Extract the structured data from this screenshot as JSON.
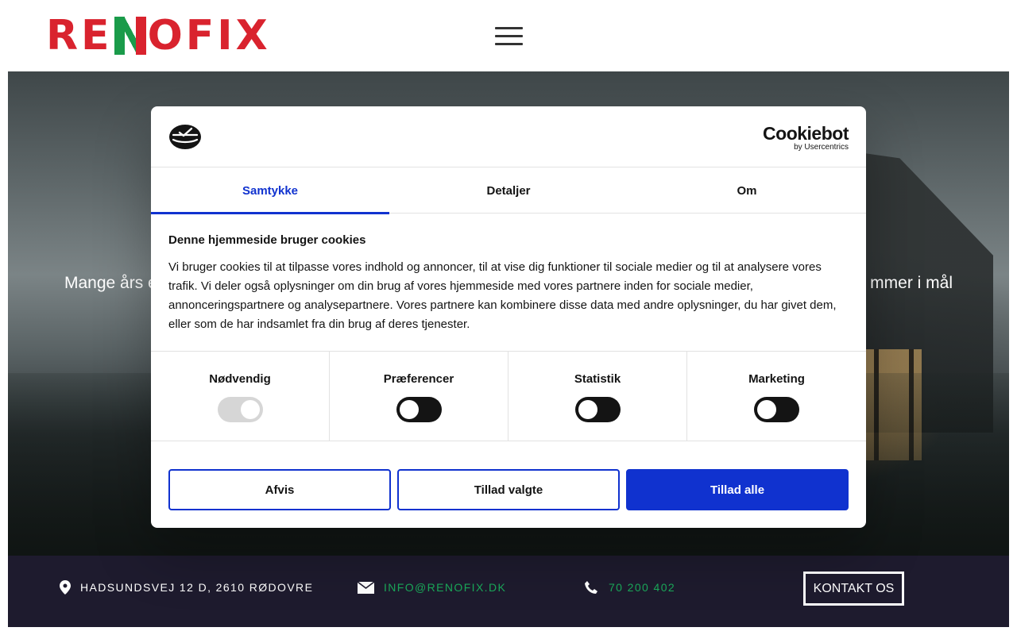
{
  "header": {
    "logo_letters": {
      "pre": "RE",
      "post": "OFIX"
    },
    "menu_icon": "hamburger-icon"
  },
  "hero": {
    "text_left": "Mange års e",
    "text_right": "mmer i mål"
  },
  "contact": {
    "address": "HADSUNDSVEJ 12 D, 2610 RØDOVRE",
    "email": "INFO@RENOFIX.DK",
    "phone": "70 200 402",
    "button_label": "KONTAKT OS",
    "icons": [
      "map-pin-icon",
      "envelope-icon",
      "phone-icon"
    ]
  },
  "cookie_dialog": {
    "brand": {
      "name": "Cookiebot",
      "by": "by Usercentrics"
    },
    "tabs": [
      {
        "label": "Samtykke",
        "active": true
      },
      {
        "label": "Detaljer",
        "active": false
      },
      {
        "label": "Om",
        "active": false
      }
    ],
    "title": "Denne hjemmeside bruger cookies",
    "text": "Vi bruger cookies til at tilpasse vores indhold og annoncer, til at vise dig funktioner til sociale medier og til at analysere vores trafik. Vi deler også oplysninger om din brug af vores hjemmeside med vores partnere inden for sociale medier, annonceringspartnere og analysepartnere. Vores partnere kan kombinere disse data med andre oplysninger, du har givet dem, eller som de har indsamlet fra din brug af deres tjenester.",
    "toggles": [
      {
        "label": "Nødvendig",
        "enabled": true,
        "disabled": true
      },
      {
        "label": "Præferencer",
        "enabled": false,
        "disabled": false
      },
      {
        "label": "Statistik",
        "enabled": false,
        "disabled": false
      },
      {
        "label": "Marketing",
        "enabled": false,
        "disabled": false
      }
    ],
    "buttons": {
      "deny": "Afvis",
      "allow_selected": "Tillad valgte",
      "allow_all": "Tillad alle"
    },
    "colors": {
      "accent": "#1032cf",
      "text": "#141414"
    }
  }
}
